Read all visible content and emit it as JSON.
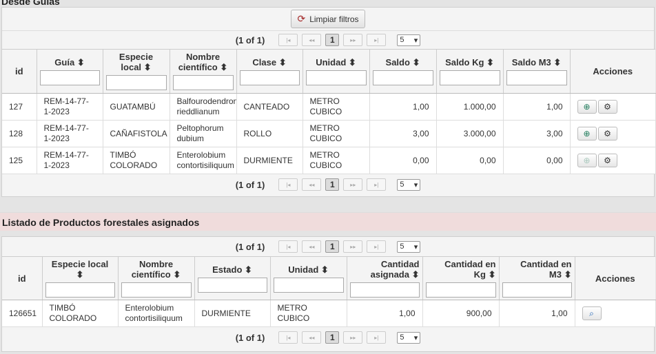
{
  "section1": {
    "title": "Desde Guías",
    "clear_filters": "Limpiar filtros",
    "pager": {
      "count": "(1 of 1)",
      "page": "1",
      "per_page": "5"
    },
    "headers": {
      "id": "id",
      "guia": "Guía",
      "especie": "Especie local",
      "nombre": "Nombre científico",
      "clase": "Clase",
      "unidad": "Unidad",
      "saldo": "Saldo",
      "saldo_kg": "Saldo Kg",
      "saldo_m3": "Saldo M3",
      "acciones": "Acciones"
    },
    "rows": [
      {
        "id": "127",
        "guia": "REM-14-77-1-2023",
        "especie": "GUATAMBÚ",
        "nombre": "Balfourodendron rieddlianum",
        "clase": "CANTEADO",
        "unidad": "METRO CUBICO",
        "saldo": "1,00",
        "saldo_kg": "1.000,00",
        "saldo_m3": "1,00"
      },
      {
        "id": "128",
        "guia": "REM-14-77-1-2023",
        "especie": "CAÑAFISTOLA",
        "nombre": "Peltophorum dubium",
        "clase": "ROLLO",
        "unidad": "METRO CUBICO",
        "saldo": "3,00",
        "saldo_kg": "3.000,00",
        "saldo_m3": "3,00"
      },
      {
        "id": "125",
        "guia": "REM-14-77-1-2023",
        "especie": "TIMBÓ COLORADO",
        "nombre": "Enterolobium contortisiliquum",
        "clase": "DURMIENTE",
        "unidad": "METRO CUBICO",
        "saldo": "0,00",
        "saldo_kg": "0,00",
        "saldo_m3": "0,00"
      }
    ]
  },
  "section2": {
    "title": "Listado de Productos forestales asignados",
    "pager": {
      "count": "(1 of 1)",
      "page": "1",
      "per_page": "5"
    },
    "headers": {
      "id": "id",
      "especie": "Especie local",
      "nombre": "Nombre científico",
      "estado": "Estado",
      "unidad": "Unidad",
      "cantidad": "Cantidad asignada",
      "cantidad_kg": "Cantidad en Kg",
      "cantidad_m3": "Cantidad en M3",
      "acciones": "Acciones"
    },
    "rows": [
      {
        "id": "126651",
        "especie": "TIMBÓ COLORADO",
        "nombre": "Enterolobium contortisiliquum",
        "estado": "DURMIENTE",
        "unidad": "METRO CUBICO",
        "cantidad": "1,00",
        "cantidad_kg": "900,00",
        "cantidad_m3": "1,00"
      }
    ]
  },
  "icons": {
    "sort": "⬍",
    "refresh": "⟳",
    "first": "|◂",
    "prev": "◂◂",
    "next": "▸▸",
    "last": "▸|",
    "caret": "▾",
    "go": "⊕",
    "gear": "⚙",
    "zoom": "🔍"
  }
}
